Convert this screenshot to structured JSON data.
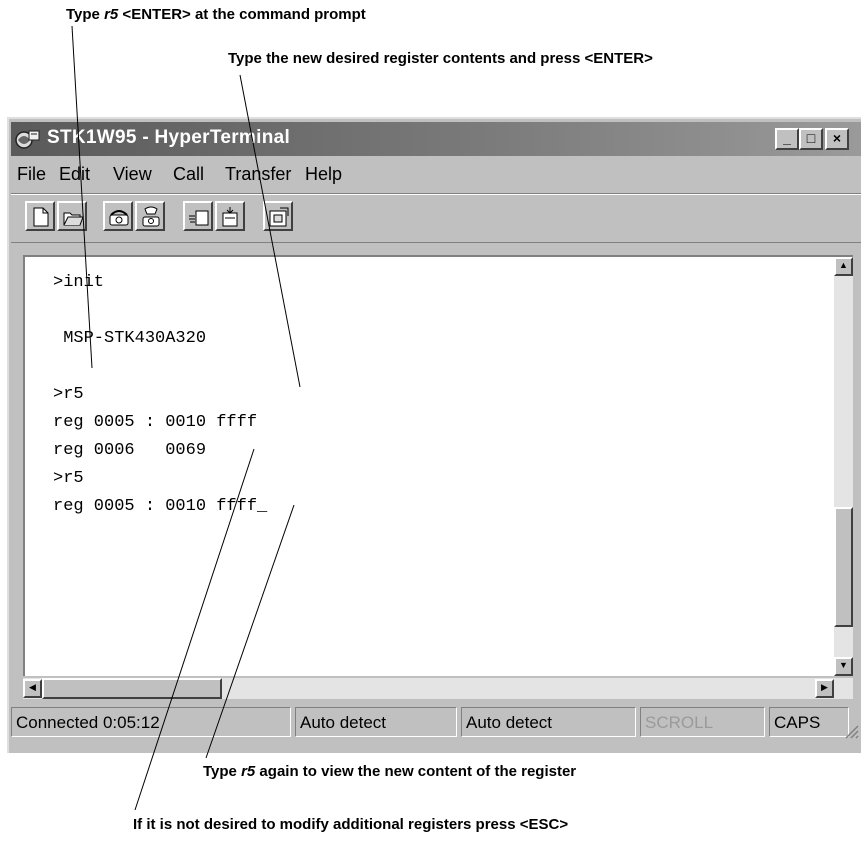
{
  "annotations": {
    "a1_prefix": "Type ",
    "a1_em": "r5",
    "a1_suffix": " <ENTER> at the command prompt",
    "a2": "Type the new desired register contents and press <ENTER>",
    "a3_prefix": "Type ",
    "a3_em": "r5",
    "a3_suffix": " again to view the new content of the register",
    "a4": "If it is not desired to modify additional registers press <ESC>"
  },
  "window": {
    "title": "STK1W95 - HyperTerminal",
    "minimize": "_",
    "maximize": "□",
    "close": "×"
  },
  "menu": {
    "file": "File",
    "edit": "Edit",
    "view": "View",
    "call": "Call",
    "transfer": "Transfer",
    "help": "Help"
  },
  "terminal": {
    "lines": [
      ">init",
      "",
      " MSP-STK430A320",
      "",
      ">r5",
      "reg 0005 : 0010 ffff",
      "reg 0006   0069",
      ">r5",
      "reg 0005 : 0010 ffff_"
    ]
  },
  "status": {
    "connected": "Connected 0:05:12",
    "detect1": "Auto detect",
    "detect2": "Auto detect",
    "scroll": "SCROLL",
    "caps": "CAPS"
  },
  "icons": {
    "app": "hyperterminal-icon",
    "new": "new-document-icon",
    "open": "open-folder-icon",
    "connect": "phone-connect-icon",
    "disconnect": "phone-disconnect-icon",
    "send": "send-file-icon",
    "receive": "receive-file-icon",
    "properties": "properties-icon"
  }
}
